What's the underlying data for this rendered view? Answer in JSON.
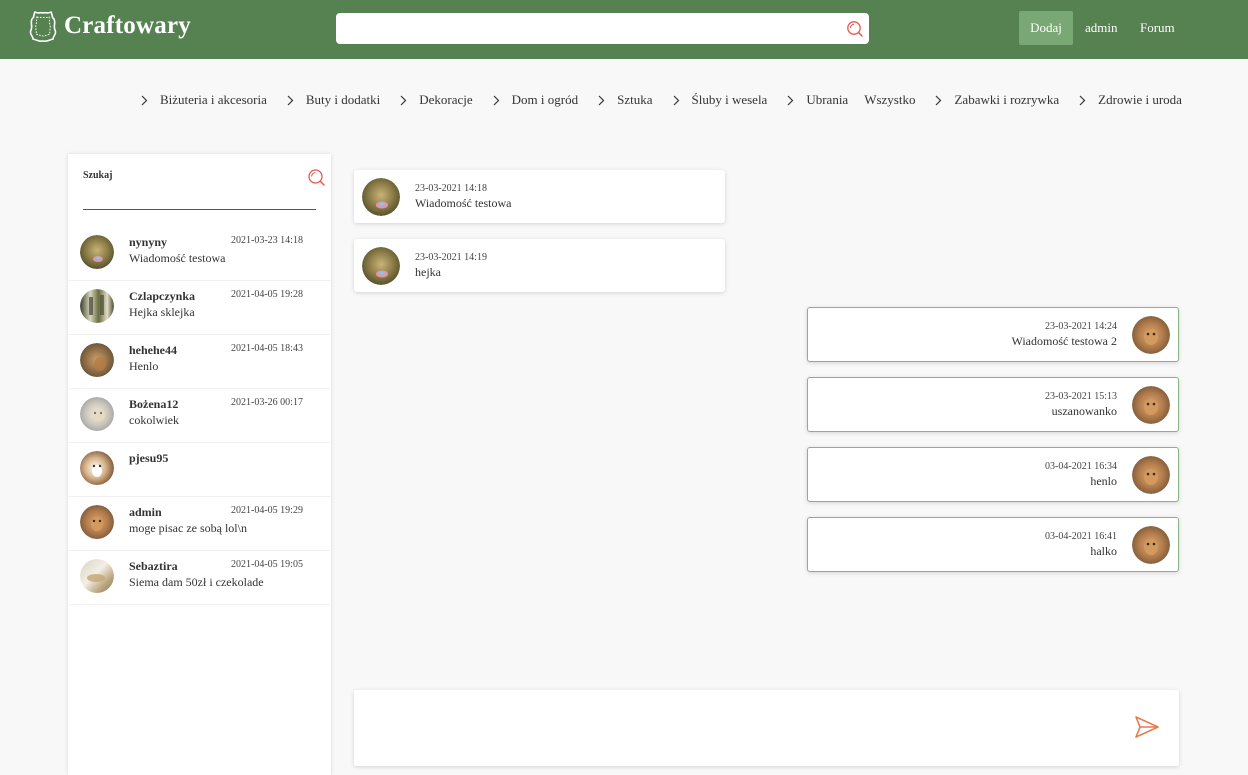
{
  "header": {
    "brand": "Craftowary",
    "search": {
      "value": "",
      "placeholder": ""
    },
    "add_label": "Dodaj",
    "admin_label": "admin",
    "forum_label": "Forum",
    "colors": {
      "bar": "#568151",
      "add_button": "#7aa874",
      "accent": "#e8584f"
    }
  },
  "categories": [
    {
      "label": "Biżuteria i akcesoria",
      "chevron": true
    },
    {
      "label": "Buty i dodatki",
      "chevron": true
    },
    {
      "label": "Dekoracje",
      "chevron": true
    },
    {
      "label": "Dom i ogród",
      "chevron": true
    },
    {
      "label": "Sztuka",
      "chevron": true
    },
    {
      "label": "Śluby i wesela",
      "chevron": true
    },
    {
      "label": "Ubrania",
      "chevron": true
    },
    {
      "label": "Wszystko",
      "chevron": false
    },
    {
      "label": "Zabawki i rozrywka",
      "chevron": true
    },
    {
      "label": "Zdrowie i uroda",
      "chevron": true
    }
  ],
  "sidebar": {
    "search_label": "Szukaj",
    "search_value": "",
    "conversations": [
      {
        "name": "nynyny",
        "date": "2021-03-23 14:18",
        "message": "Wiadomość testowa",
        "avatar": "avatar-baby"
      },
      {
        "name": "Czlapczynka",
        "date": "2021-04-05 19:28",
        "message": "Hejka sklejka",
        "avatar": "avatar-bottles"
      },
      {
        "name": "hehehe44",
        "date": "2021-04-05 18:43",
        "message": "Henlo",
        "avatar": "avatar-dog"
      },
      {
        "name": "Bożena12",
        "date": "2021-03-26 00:17",
        "message": "cokolwiek",
        "avatar": "avatar-cat"
      },
      {
        "name": "pjesu95",
        "date": "",
        "message": "",
        "avatar": "avatar-husky"
      },
      {
        "name": "admin",
        "date": "2021-04-05 19:29",
        "message": "moge pisac ze sobą lol\\n",
        "avatar": "avatar-admin"
      },
      {
        "name": "Sebaztira",
        "date": "2021-04-05 19:05",
        "message": "Siema dam 50zł i czekolade",
        "avatar": "avatar-food"
      }
    ]
  },
  "chat": {
    "messages": [
      {
        "direction": "in",
        "date": "23-03-2021 14:18",
        "text": "Wiadomość testowa"
      },
      {
        "direction": "in",
        "date": "23-03-2021 14:19",
        "text": "hejka"
      },
      {
        "direction": "out",
        "date": "23-03-2021 14:24",
        "text": "Wiadomość testowa 2"
      },
      {
        "direction": "out",
        "date": "23-03-2021 15:13",
        "text": "uszanowanko"
      },
      {
        "direction": "out",
        "date": "03-04-2021 16:34",
        "text": "henlo"
      },
      {
        "direction": "out",
        "date": "03-04-2021 16:41",
        "text": "halko"
      }
    ],
    "composer": {
      "value": "",
      "placeholder": ""
    }
  }
}
